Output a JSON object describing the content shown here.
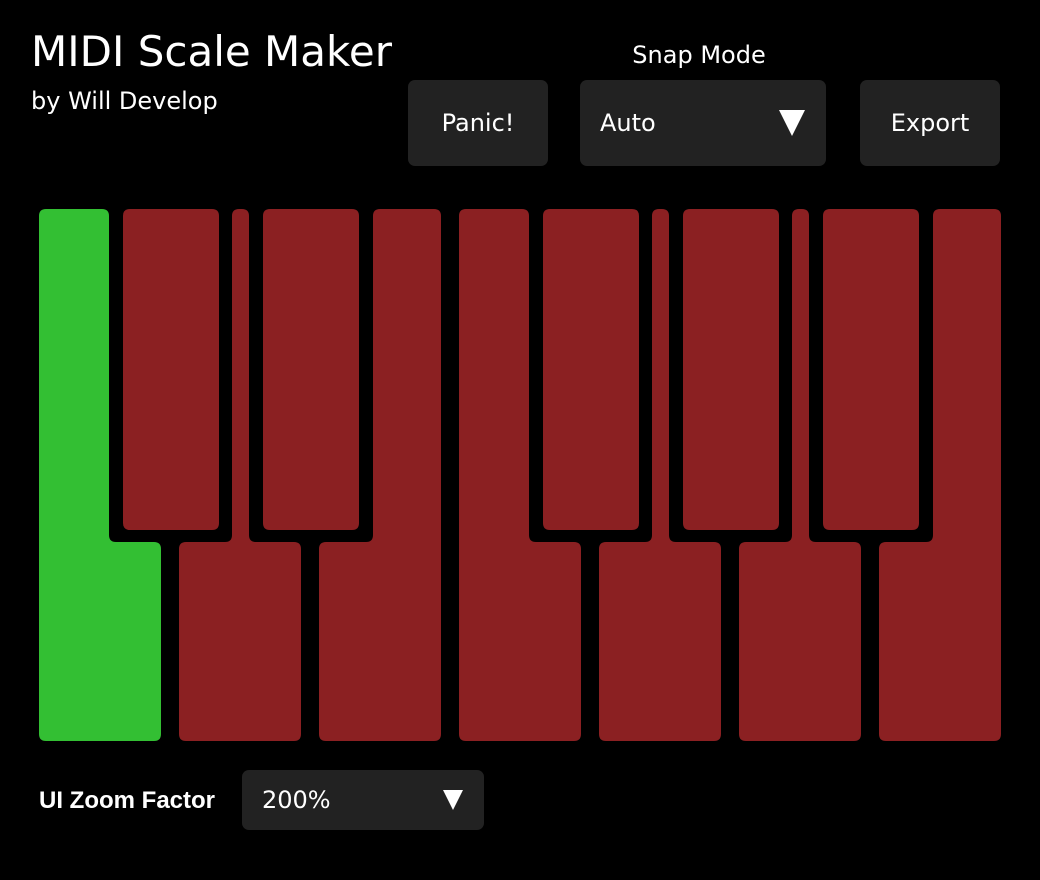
{
  "app": {
    "title": "MIDI Scale Maker",
    "subtitle": "by Will Develop"
  },
  "toolbar": {
    "panic_label": "Panic!",
    "snap_mode_label": "Snap Mode",
    "snap_mode_value": "Auto",
    "export_label": "Export"
  },
  "keyboard": {
    "active_color": "#33bf33",
    "inactive_color": "#8b2022",
    "keys": [
      {
        "note": "C",
        "type": "white",
        "enabled": true
      },
      {
        "note": "C#",
        "type": "black",
        "enabled": false
      },
      {
        "note": "D",
        "type": "white",
        "enabled": false
      },
      {
        "note": "D#",
        "type": "black",
        "enabled": false
      },
      {
        "note": "E",
        "type": "white",
        "enabled": false
      },
      {
        "note": "F",
        "type": "white",
        "enabled": false
      },
      {
        "note": "F#",
        "type": "black",
        "enabled": false
      },
      {
        "note": "G",
        "type": "white",
        "enabled": false
      },
      {
        "note": "G#",
        "type": "black",
        "enabled": false
      },
      {
        "note": "A",
        "type": "white",
        "enabled": false
      },
      {
        "note": "A#",
        "type": "black",
        "enabled": false
      },
      {
        "note": "B",
        "type": "white",
        "enabled": false
      }
    ]
  },
  "zoom": {
    "label": "UI Zoom Factor",
    "value": "200%"
  },
  "icons": {
    "snap_dropdown": "chevron-down-icon",
    "zoom_dropdown": "chevron-down-icon"
  }
}
